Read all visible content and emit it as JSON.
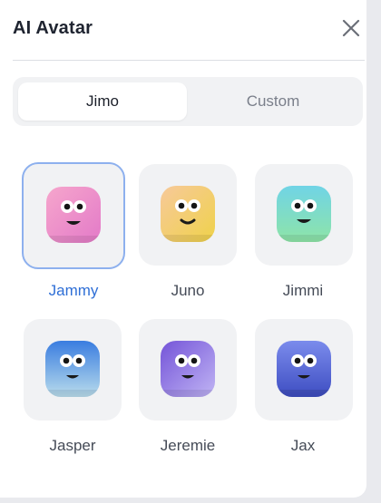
{
  "panel": {
    "title": "AI Avatar",
    "close_icon": "close-icon"
  },
  "tabs": [
    {
      "label": "Jimo",
      "active": true
    },
    {
      "label": "Custom",
      "active": false
    }
  ],
  "avatars": [
    {
      "name": "Jammy",
      "selected": true,
      "colors": [
        "#f6a6cc",
        "#e37ac8"
      ]
    },
    {
      "name": "Juno",
      "selected": false,
      "colors": [
        "#f7d287",
        "#efd24a"
      ]
    },
    {
      "name": "Jimmi",
      "selected": false,
      "colors": [
        "#70d4e6",
        "#8ee4a8"
      ]
    },
    {
      "name": "Jasper",
      "selected": false,
      "colors": [
        "#3a7de0",
        "#b9dcec"
      ]
    },
    {
      "name": "Jeremie",
      "selected": false,
      "colors": [
        "#7454d8",
        "#c0b4f4"
      ]
    },
    {
      "name": "Jax",
      "selected": false,
      "colors": [
        "#6d7fe6",
        "#3e4ec2"
      ]
    }
  ],
  "colors": {
    "accent": "#2f6fd6",
    "selected_border": "#8db0ee"
  }
}
